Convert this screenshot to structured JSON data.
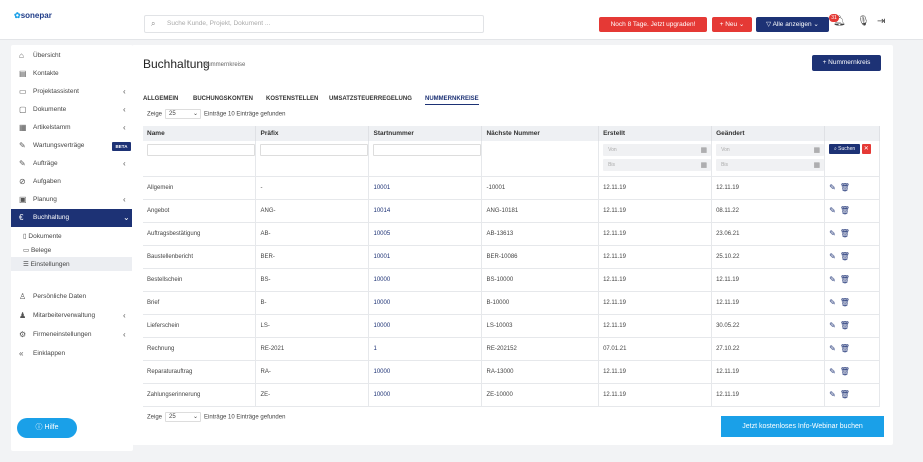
{
  "header": {
    "logo": "sonepar",
    "search_placeholder": "Suche Kunde, Projekt, Dokument ...",
    "upgrade_label": "Noch 8 Tage. Jetzt upgraden!",
    "new_label": "+ Neu",
    "show_all_label": "Alle anzeigen",
    "notification_count": "31"
  },
  "sidebar": {
    "items": [
      {
        "label": "Übersicht",
        "icon": "home-icon",
        "chevron": ""
      },
      {
        "label": "Kontakte",
        "icon": "contacts-icon",
        "chevron": ""
      },
      {
        "label": "Projektassistent",
        "icon": "folder-icon",
        "chevron": "‹"
      },
      {
        "label": "Dokumente",
        "icon": "document-icon",
        "chevron": "‹"
      },
      {
        "label": "Artikelstamm",
        "icon": "table-icon",
        "chevron": "‹"
      },
      {
        "label": "Wartungsverträge",
        "icon": "wrench-icon",
        "chevron": "",
        "badge": "BETA"
      },
      {
        "label": "Aufträge",
        "icon": "wrench-icon",
        "chevron": "‹"
      },
      {
        "label": "Aufgaben",
        "icon": "check-icon",
        "chevron": ""
      },
      {
        "label": "Planung",
        "icon": "calendar-icon",
        "chevron": "‹"
      },
      {
        "label": "Buchhaltung",
        "icon": "euro-icon",
        "chevron": "⌄"
      }
    ],
    "subitems": [
      "Dokumente",
      "Belege",
      "Einstellungen"
    ],
    "bottom_items": [
      {
        "label": "Persönliche Daten",
        "icon": "user-icon",
        "chevron": ""
      },
      {
        "label": "Mitarbeiterverwaltung",
        "icon": "users-icon",
        "chevron": "‹"
      },
      {
        "label": "Firmeneinstellungen",
        "icon": "gear-icon",
        "chevron": "‹"
      },
      {
        "label": "Einklappen",
        "icon": "collapse-icon",
        "chevron": ""
      }
    ],
    "help_label": "Hilfe"
  },
  "page": {
    "title": "Buchhaltung",
    "subtitle": "Nummernkreise",
    "new_button": "+ Nummernkreis",
    "tabs": [
      "ALLGEMEIN",
      "BUCHUNGSKONTEN",
      "KOSTENSTELLEN",
      "UMSATZSTEUERREGELUNG",
      "NUMMERNKREISE"
    ],
    "zeige_label": "Zeige",
    "page_size": "25",
    "entries_label": "Einträge",
    "found_label": "10 Einträge gefunden",
    "columns": [
      "Name",
      "Präfix",
      "Startnummer",
      "Nächste Nummer",
      "Erstellt",
      "Geändert"
    ],
    "filter": {
      "von": "Von",
      "bis": "Bis",
      "search_button": "Suchen"
    },
    "rows": [
      [
        "Allgemein",
        "-",
        "10001",
        "-10001",
        "12.11.19",
        "12.11.19"
      ],
      [
        "Angebot",
        "ANG-",
        "10014",
        "ANG-10181",
        "12.11.19",
        "08.11.22"
      ],
      [
        "Auftragsbestätigung",
        "AB-",
        "10005",
        "AB-13613",
        "12.11.19",
        "23.06.21"
      ],
      [
        "Baustellenbericht",
        "BER-",
        "10001",
        "BER-10086",
        "12.11.19",
        "25.10.22"
      ],
      [
        "Bestellschein",
        "BS-",
        "10000",
        "BS-10000",
        "12.11.19",
        "12.11.19"
      ],
      [
        "Brief",
        "B-",
        "10000",
        "B-10000",
        "12.11.19",
        "12.11.19"
      ],
      [
        "Lieferschein",
        "LS-",
        "10000",
        "LS-10003",
        "12.11.19",
        "30.05.22"
      ],
      [
        "Rechnung",
        "RE-2021",
        "1",
        "RE-202152",
        "07.01.21",
        "27.10.22"
      ],
      [
        "Reparaturauftrag",
        "RA-",
        "10000",
        "RA-13000",
        "12.11.19",
        "12.11.19"
      ],
      [
        "Zahlungserinnerung",
        "ZE-",
        "10000",
        "ZE-10000",
        "12.11.19",
        "12.11.19"
      ]
    ],
    "webinar_label": "Jetzt kostenloses Info-Webinar buchen"
  }
}
